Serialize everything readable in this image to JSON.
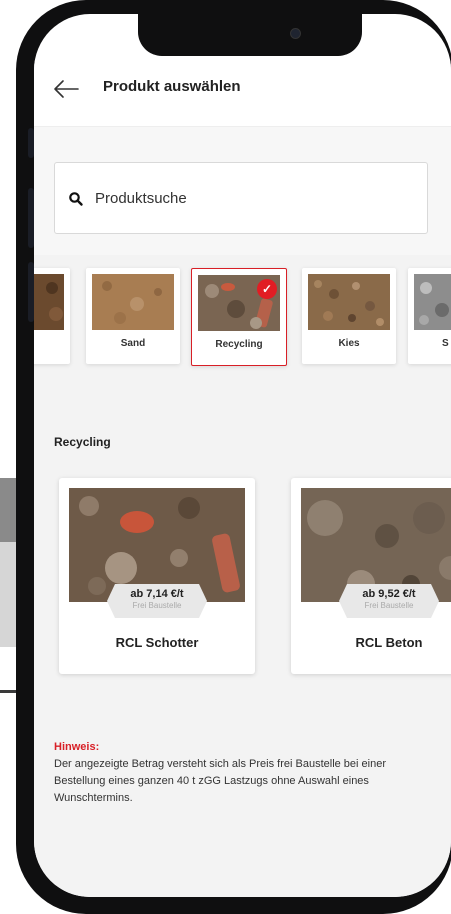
{
  "header": {
    "title": "Produkt auswählen"
  },
  "search": {
    "placeholder": "Produktsuche"
  },
  "categories": [
    {
      "label": ""
    },
    {
      "label": "Sand"
    },
    {
      "label": "Recycling",
      "selected": true
    },
    {
      "label": "Kies"
    },
    {
      "label": "S"
    }
  ],
  "section": {
    "title": "Recycling"
  },
  "products": [
    {
      "price": "ab 7,14 €/t",
      "price_note": "Frei Baustelle",
      "name": "RCL Schotter"
    },
    {
      "price": "ab 9,52 €/t",
      "price_note": "Frei Baustelle",
      "name": "RCL Beton"
    }
  ],
  "hint": {
    "label": "Hinweis:",
    "text": "Der angezeigte Betrag versteht sich als Preis frei Baustelle bei einer Bestellung eines ganzen 40 t zGG Lastzugs ohne Auswahl eines Wunschtermins."
  },
  "colors": {
    "accent": "#d81f26",
    "background": "#f3f3f3"
  }
}
